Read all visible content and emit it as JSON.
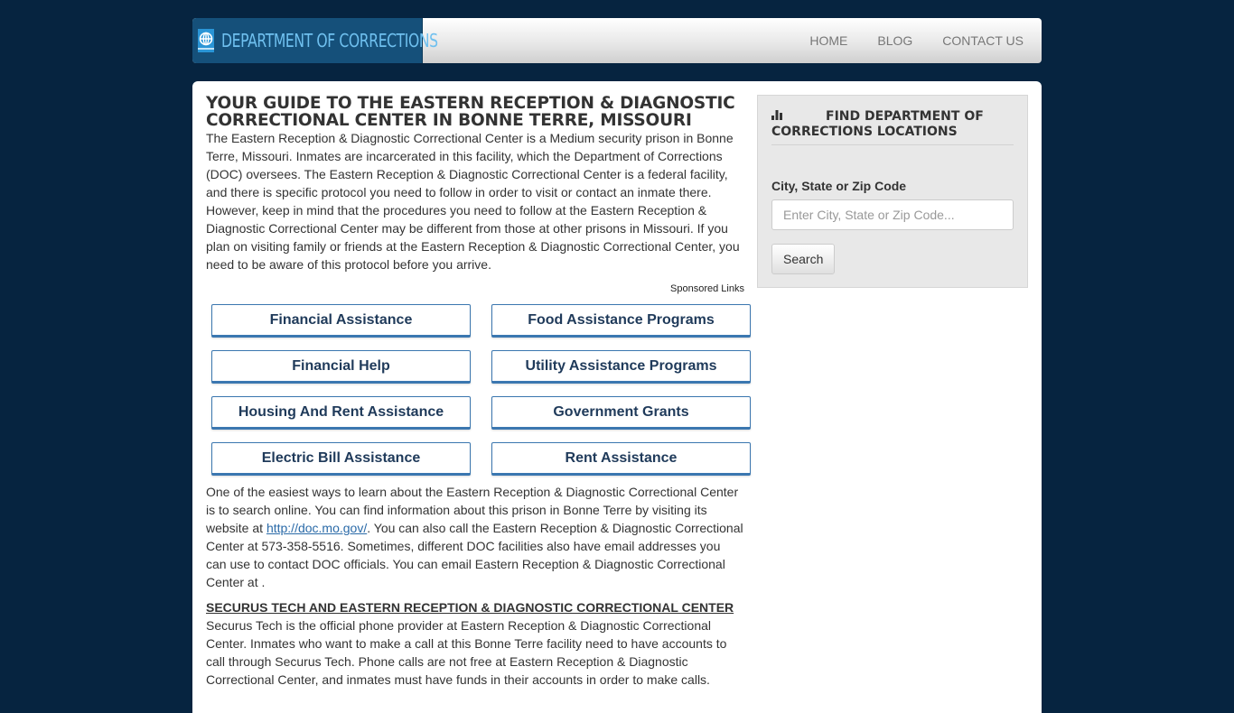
{
  "header": {
    "brand": "DEPARTMENT OF CORRECTIONS",
    "brand_icon": "globe-badge-icon",
    "nav": [
      "HOME",
      "BLOG",
      "CONTACT US"
    ]
  },
  "main": {
    "title": "YOUR GUIDE TO THE EASTERN RECEPTION & DIAGNOSTIC CORRECTIONAL CENTER IN BONNE TERRE, MISSOURI",
    "intro": "The Eastern Reception & Diagnostic Correctional Center is a Medium security prison in Bonne Terre, Missouri. Inmates are incarcerated in this facility, which the Department of Corrections (DOC) oversees. The Eastern Reception & Diagnostic Correctional Center is a federal facility, and there is specific protocol you need to follow in order to visit or contact an inmate there. However, keep in mind that the procedures you need to follow at the Eastern Reception & Diagnostic Correctional Center may be different from those at other prisons in Missouri. If you plan on visiting family or friends at the Eastern Reception & Diagnostic Correctional Center, you need to be aware of this protocol before you arrive.",
    "sponsored_label": "Sponsored Links",
    "ad_buttons": [
      "Financial Assistance",
      "Food Assistance Programs",
      "Financial Help",
      "Utility Assistance Programs",
      "Housing And Rent Assistance",
      "Government Grants",
      "Electric Bill Assistance",
      "Rent Assistance"
    ],
    "para2_before": "One of the easiest ways to learn about the Eastern Reception & Diagnostic Correctional Center is to search online. You can find information about this prison in Bonne Terre by visiting its website at ",
    "para2_link": "http://doc.mo.gov/",
    "para2_after": ". You can also call the Eastern Reception & Diagnostic Correctional Center at 573-358-5516. Sometimes, different DOC facilities also have email addresses you can use to contact DOC officials. You can email Eastern Reception & Diagnostic Correctional Center at .",
    "section2_heading": "SECURUS TECH AND EASTERN RECEPTION & DIAGNOSTIC CORRECTIONAL CENTER",
    "section2_text": "Securus Tech is the official phone provider at Eastern Reception & Diagnostic Correctional Center. Inmates who want to make a call at this Bonne Terre facility need to have accounts to call through Securus Tech. Phone calls are not free at Eastern Reception & Diagnostic Correctional Center, and inmates must have funds in their accounts in order to make calls."
  },
  "sidebar": {
    "title": "FIND DEPARTMENT OF CORRECTIONS LOCATIONS",
    "title_icon": "bar-chart-icon",
    "field_label": "City, State or Zip Code",
    "input_value": "",
    "input_placeholder": "Enter City, State or Zip Code...",
    "search_label": "Search"
  },
  "colors": {
    "page_bg": "#062440",
    "brand_bg": "#15507a",
    "brand_text": "#6fc0ef",
    "button_border": "#3b77b0",
    "button_text": "#1f3a5a",
    "link": "#2a6aa8"
  }
}
